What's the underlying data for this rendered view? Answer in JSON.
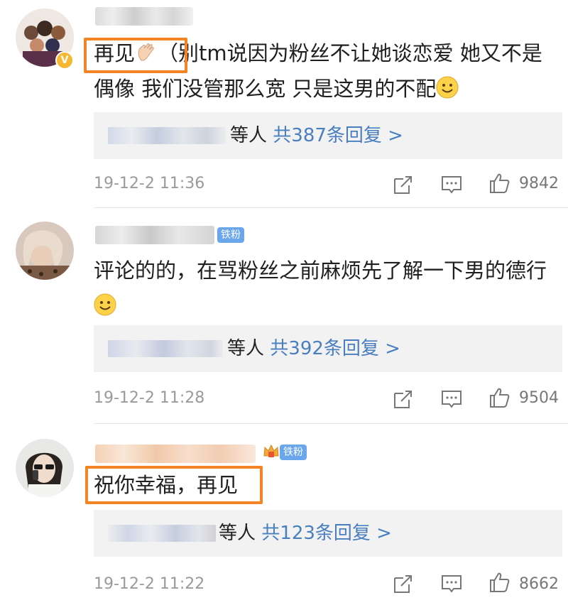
{
  "comments": [
    {
      "content_pre": "",
      "highlight": "再见",
      "content_post": "（别tm说因为粉丝不让她谈恋爱 她又不是偶像 我们没管那么宽 只是这男的不配",
      "reply_deng": "等人",
      "reply_link": "共387条回复 >",
      "time": "19-12-2 11:36",
      "likes": "9842"
    },
    {
      "fan_label": "铁粉",
      "content": "评论的的，在骂粉丝之前麻烦先了解一下男的德行",
      "reply_deng": "等人",
      "reply_link": "共392条回复 >",
      "time": "19-12-2 11:28",
      "likes": "9504"
    },
    {
      "fan_label": "铁粉",
      "highlight": "祝你幸福，再见",
      "reply_deng": "等人",
      "reply_link": "共123条回复 >",
      "time": "19-12-2 11:22",
      "likes": "8662"
    }
  ],
  "colors": {
    "highlight_border": "#f48424",
    "link": "#4a7fbf",
    "fan_badge": "#6aa6ec",
    "verify_badge": "#f7b731",
    "reply_bg": "#f2f2f2",
    "meta_text": "#9a9a9a"
  },
  "icons": [
    "share-icon",
    "comment-icon",
    "like-icon",
    "verified-icon",
    "crown-icon",
    "smile-emoji",
    "wave-emoji"
  ]
}
